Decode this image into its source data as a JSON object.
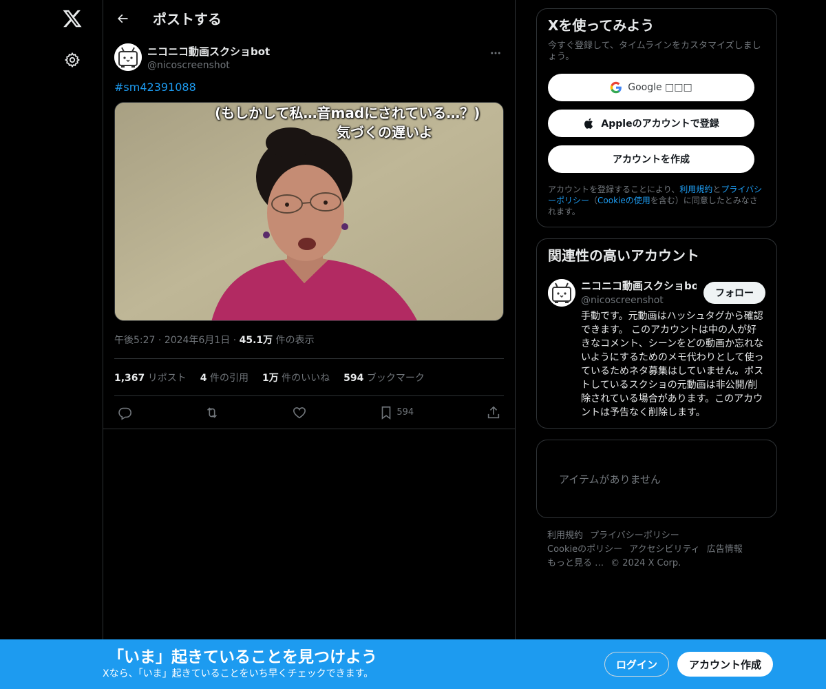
{
  "nav": {
    "logo_icon": "x-logo-icon",
    "settings_icon": "gear-icon"
  },
  "header": {
    "title": "ポストする"
  },
  "post": {
    "author_name": "ニコニコ動画スクショbot",
    "author_handle": "@nicoscreenshot",
    "hashtag": "#sm42391088",
    "caption_line1": "(もしかして私…音madにされている…？)",
    "caption_line2": "気づくの遅いよ",
    "time": "午後5:27",
    "date": "2024年6月1日",
    "views_count": "45.1万",
    "views_label": "件の表示",
    "sep": "·",
    "reposts_count": "1,367",
    "reposts_label": "リポスト",
    "quotes_count": "4",
    "quotes_label": "件の引用",
    "likes_count": "1万",
    "likes_label": "件のいいね",
    "bookmarks_count": "594",
    "bookmarks_label": "ブックマーク",
    "bookmark_action_count": "594"
  },
  "signup": {
    "title": "Xを使ってみよう",
    "subtitle": "今すぐ登録して、タイムラインをカスタマイズしましょう。",
    "google_label": "Google □□□",
    "apple_label": "Appleのアカウントで登録",
    "create_label": "アカウントを作成",
    "legal_prefix": "アカウントを登録することにより、",
    "legal_terms": "利用規約",
    "legal_and": "と",
    "legal_privacy": "プライバシーポリシー",
    "legal_paren_open": "（",
    "legal_cookie": "Cookieの使用",
    "legal_suffix": "を含む）に同意したとみなされます。"
  },
  "related": {
    "title": "関連性の高いアカウント",
    "name": "ニコニコ動画スクショbot",
    "handle": "@nicoscreenshot",
    "follow_label": "フォロー",
    "bio": "手動です。元動画はハッシュタグから確認できます。 このアカウントは中の人が好きなコメント、シーンをどの動画か忘れないようにするためのメモ代わりとして使っているためネタ募集はしていません。ポストしているスクショの元動画は非公開/削除されている場合があります。このアカウントは予告なく削除します。"
  },
  "trends": {
    "empty_text": "アイテムがありません"
  },
  "footer": {
    "terms": "利用規約",
    "privacy": "プライバシーポリシー",
    "cookie": "Cookieのポリシー",
    "accessibility": "アクセシビリティ",
    "ads": "広告情報",
    "more": "もっと見る …",
    "copyright": "© 2024 X Corp."
  },
  "bottombar": {
    "title": "「いま」起きていることを見つけよう",
    "subtitle": "Xなら、「いま」起きていることをいち早くチェックできます。",
    "login_label": "ログイン",
    "signup_label": "アカウント作成"
  },
  "colors": {
    "accent": "#1d9bf0",
    "background": "#000000",
    "border": "#2f3336",
    "muted": "#71767b"
  }
}
